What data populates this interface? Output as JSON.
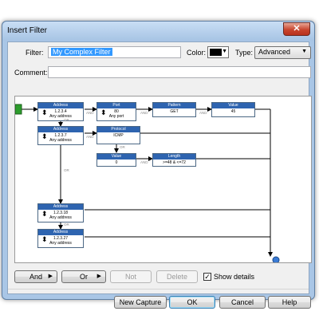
{
  "window": {
    "title": "Insert Filter",
    "close_glyph": "✕"
  },
  "form": {
    "filter_label": "Filter:",
    "filter_value": "My Complex Filter",
    "color_label": "Color:",
    "color_value": "#000000",
    "type_label": "Type:",
    "type_value": "Advanced",
    "comment_label": "Comment:",
    "comment_value": ""
  },
  "diagram": {
    "nodes": [
      {
        "id": "n1",
        "title": "Address",
        "lines": [
          "1.2.3.4",
          "Any address"
        ],
        "bidirectional": true
      },
      {
        "id": "n2",
        "title": "Port",
        "lines": [
          "80",
          "Any port"
        ],
        "bidirectional": true
      },
      {
        "id": "n3",
        "title": "Pattern",
        "lines": [
          "GET"
        ],
        "bidirectional": false
      },
      {
        "id": "n4",
        "title": "Value",
        "lines": [
          "45"
        ],
        "bidirectional": false
      },
      {
        "id": "n5",
        "title": "Address",
        "lines": [
          "1.2.3.7",
          "Any address"
        ],
        "bidirectional": true
      },
      {
        "id": "n6",
        "title": "Protocol",
        "lines": [
          "ICMP"
        ],
        "bidirectional": false
      },
      {
        "id": "n7",
        "title": "Value",
        "lines": [
          "0"
        ],
        "bidirectional": false
      },
      {
        "id": "n8",
        "title": "Length",
        "lines": [
          ">=48 & <=72"
        ],
        "bidirectional": false
      },
      {
        "id": "n9",
        "title": "Address",
        "lines": [
          "1.2.3.18",
          "Any address"
        ],
        "bidirectional": true
      },
      {
        "id": "n10",
        "title": "Address",
        "lines": [
          "1.2.3.27",
          "Any address"
        ],
        "bidirectional": true
      }
    ],
    "and_label": "AND",
    "or_label": "OR"
  },
  "buttons": {
    "and": "And",
    "or": "Or",
    "not": "Not",
    "delete": "Delete",
    "show_details": "Show details",
    "show_details_checked": true,
    "new_capture": "New Capture",
    "ok": "OK",
    "cancel": "Cancel",
    "help": "Help"
  },
  "icons": {
    "play": "▶",
    "dropdown": "▼",
    "bidirectional": "⬍",
    "check": "✓"
  }
}
